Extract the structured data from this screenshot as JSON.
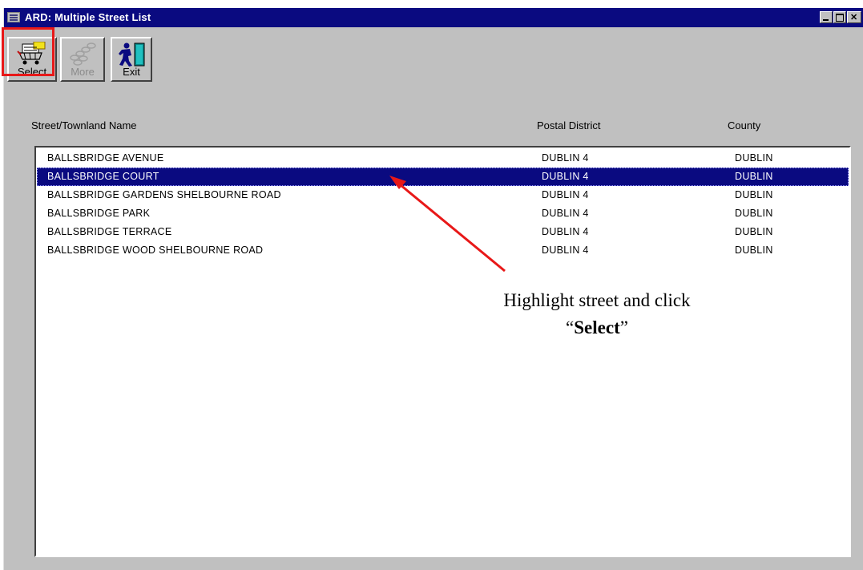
{
  "window": {
    "title": "ARD: Multiple Street List"
  },
  "toolbar": {
    "select_label": "Select",
    "more_label": "More",
    "exit_label": "Exit"
  },
  "columns": {
    "street": "Street/Townland Name",
    "district": "Postal District",
    "county": "County"
  },
  "rows": [
    {
      "street": "BALLSBRIDGE AVENUE",
      "district": "DUBLIN 4",
      "county": "DUBLIN",
      "selected": false
    },
    {
      "street": "BALLSBRIDGE COURT",
      "district": "DUBLIN 4",
      "county": "DUBLIN",
      "selected": true
    },
    {
      "street": "BALLSBRIDGE GARDENS SHELBOURNE ROAD",
      "district": "DUBLIN 4",
      "county": "DUBLIN",
      "selected": false
    },
    {
      "street": "BALLSBRIDGE PARK",
      "district": "DUBLIN 4",
      "county": "DUBLIN",
      "selected": false
    },
    {
      "street": "BALLSBRIDGE TERRACE",
      "district": "DUBLIN 4",
      "county": "DUBLIN",
      "selected": false
    },
    {
      "street": "BALLSBRIDGE WOOD SHELBOURNE ROAD",
      "district": "DUBLIN 4",
      "county": "DUBLIN",
      "selected": false
    }
  ],
  "annotation": {
    "line1": "Highlight street and click",
    "quote_open": "“",
    "select_word": "Select",
    "quote_close": "”"
  },
  "colors": {
    "titlebar": "#0a0a80",
    "selection": "#0a0a80",
    "highlight_box": "#e81818",
    "arrow": "#e81818"
  },
  "icons": {
    "select": "cart-with-papers-icon",
    "more": "chain-links-icon",
    "exit": "running-man-door-icon"
  }
}
